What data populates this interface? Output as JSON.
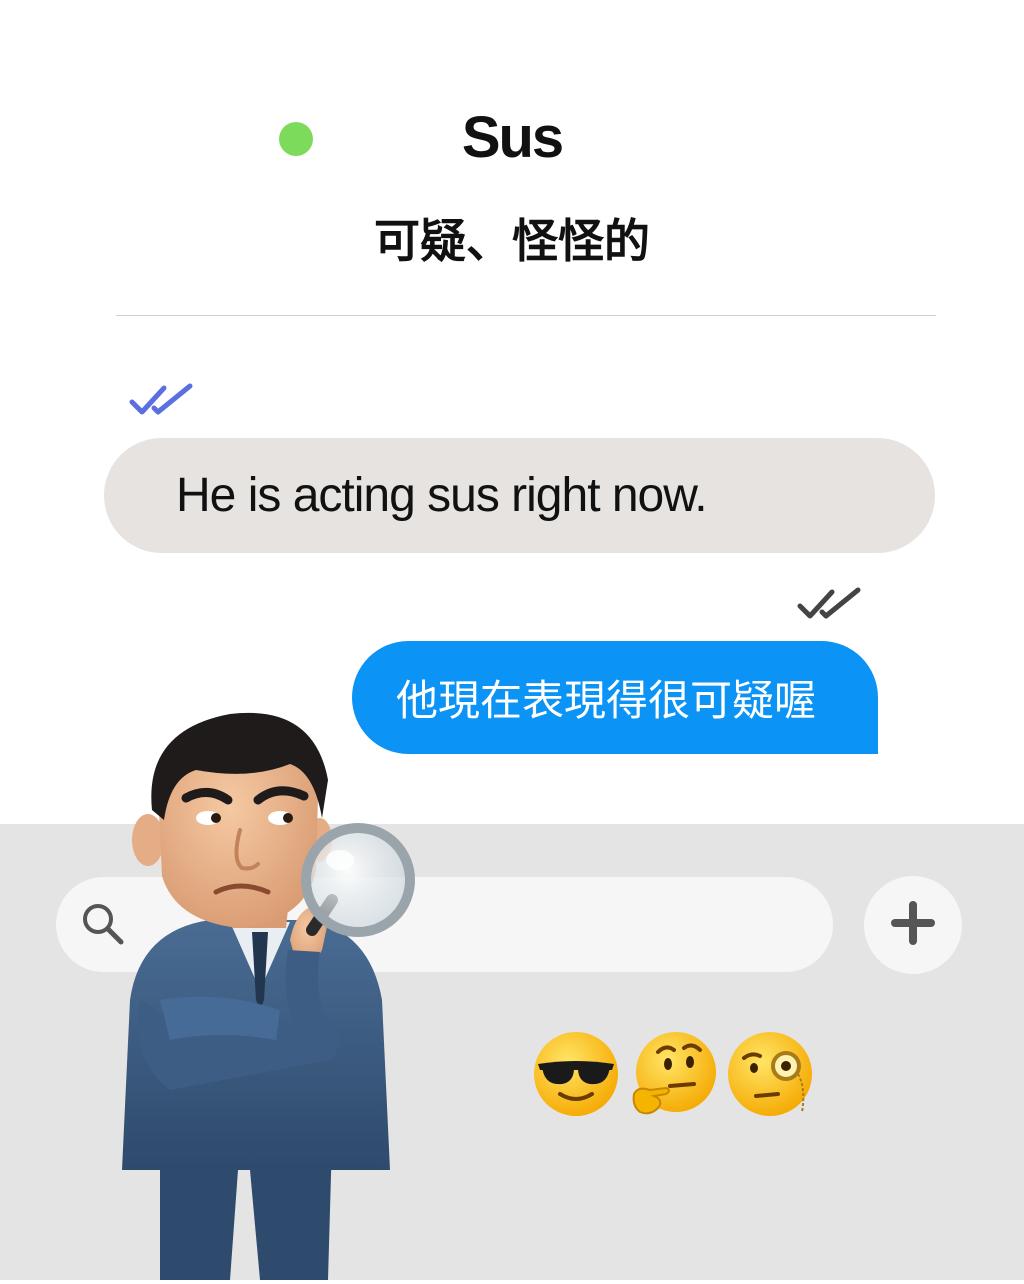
{
  "header": {
    "status": "online",
    "status_color": "#7ddb5b",
    "title": "Sus",
    "subtitle": "可疑、怪怪的"
  },
  "messages": [
    {
      "direction": "incoming",
      "text": "He is acting sus right now.",
      "read_icon": "double-check-icon",
      "read_color": "#5b6fe0",
      "bubble_color": "#e6e3e0"
    },
    {
      "direction": "outgoing",
      "text": "他現在表現得很可疑喔",
      "read_icon": "double-check-icon",
      "read_color": "#444444",
      "bubble_color": "#0b93f6"
    }
  ],
  "composer": {
    "search_icon": "search-icon",
    "placeholder": "",
    "add_icon": "plus-icon"
  },
  "emoji": [
    "smiling-face-with-sunglasses",
    "thinking-face",
    "face-with-monocle"
  ],
  "illustration": "suspicious-man-with-magnifying-glass"
}
